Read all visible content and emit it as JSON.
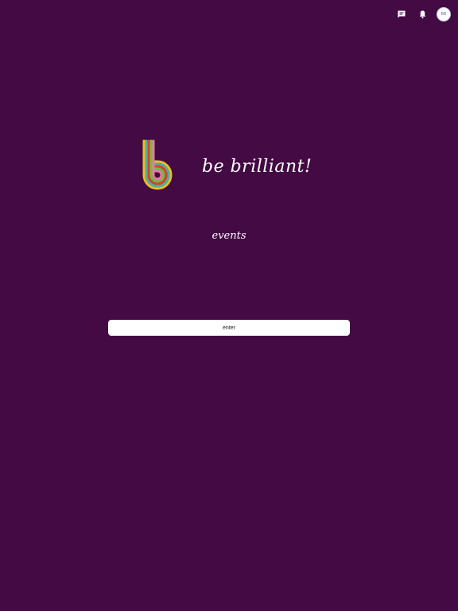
{
  "header": {
    "chat_icon": "chat-bubble-icon",
    "notification_icon": "bell-icon",
    "avatar_initials": "BB"
  },
  "logo": {
    "text": "be brilliant!",
    "colors": [
      "#e9c01f",
      "#4fb0a8",
      "#d9442b",
      "#6fbf45",
      "#e77aa0"
    ]
  },
  "main": {
    "subtitle": "events",
    "enter_label": "enter"
  },
  "colors": {
    "background": "#430a44",
    "button": "#ffffff"
  }
}
